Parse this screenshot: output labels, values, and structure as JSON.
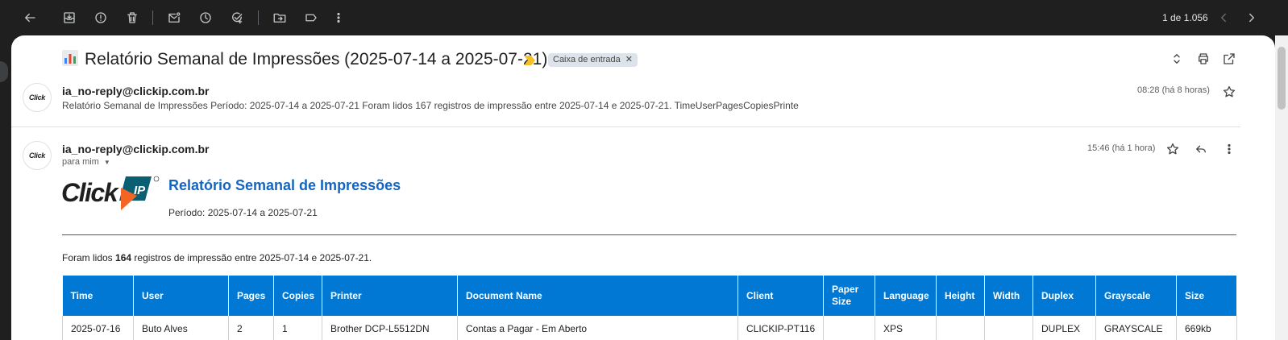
{
  "toolbar": {
    "icons": [
      "back-arrow-icon",
      "archive-icon",
      "report-spam-icon",
      "delete-icon",
      "mark-unread-icon",
      "snooze-icon",
      "add-to-tasks-icon",
      "move-to-icon",
      "label-icon",
      "more-vert-icon"
    ],
    "counter": "1 de 1.056"
  },
  "thread": {
    "subject": "Relatório Semanal de Impressões (2025-07-14 a 2025-07-21)",
    "subject_emoji": "bar-chart-icon",
    "label": "Caixa de entrada"
  },
  "message1": {
    "avatar_text": "Click",
    "sender": "ia_no-reply@clickip.com.br",
    "snippet": "Relatório Semanal de Impressões Período: 2025-07-14 a 2025-07-21 Foram lidos 167 registros de impressão entre 2025-07-14 e 2025-07-21. TimeUserPagesCopiesPrinte",
    "time": "08:28 (há 8 horas)"
  },
  "message2": {
    "avatar_text": "Click",
    "sender": "ia_no-reply@clickip.com.br",
    "to": "para mim",
    "time": "15:46 (há 1 hora)",
    "body": {
      "logo_text": "Click",
      "logo_badge": "IP",
      "title": "Relatório Semanal de Impressões",
      "period": "Período: 2025-07-14 a 2025-07-21",
      "intro_before": "Foram lidos ",
      "intro_count": "164",
      "intro_after": " registros de impressão entre 2025-07-14 e 2025-07-21.",
      "table": {
        "headers": [
          "Time",
          "User",
          "Pages",
          "Copies",
          "Printer",
          "Document Name",
          "Client",
          "Paper Size",
          "Language",
          "Height",
          "Width",
          "Duplex",
          "Grayscale",
          "Size"
        ],
        "rows": [
          [
            "2025-07-16",
            "Buto Alves",
            "2",
            "1",
            "Brother DCP-L5512DN",
            "Contas a Pagar - Em Aberto",
            "CLICKIP-PT116",
            "",
            "XPS",
            "",
            "",
            "DUPLEX",
            "GRAYSCALE",
            "669kb"
          ]
        ]
      }
    }
  },
  "colors": {
    "accent_blue": "#1565c0",
    "table_header_bg": "#0078d4",
    "important_marker": "#f6bf26"
  }
}
